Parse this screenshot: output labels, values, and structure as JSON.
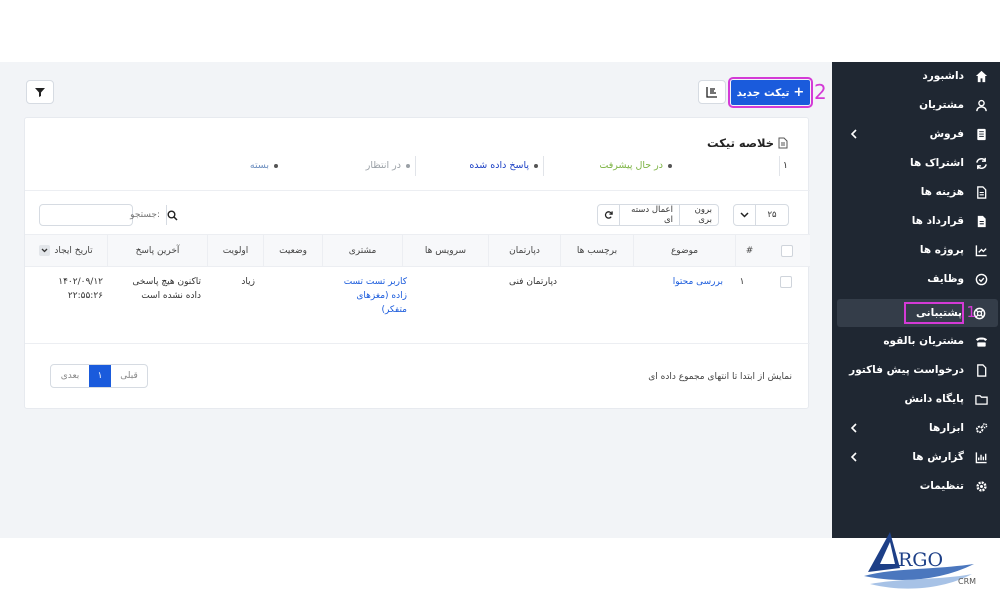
{
  "sidebar": {
    "items": [
      {
        "label": "داشبورد",
        "icon": "home-icon",
        "chevron": false
      },
      {
        "label": "مشتریان",
        "icon": "user-icon",
        "chevron": false
      },
      {
        "label": "فروش",
        "icon": "receipt-icon",
        "chevron": true
      },
      {
        "label": "اشتراک ها",
        "icon": "refresh-icon",
        "chevron": false
      },
      {
        "label": "هزینه ها",
        "icon": "file-text-icon",
        "chevron": false
      },
      {
        "label": "قرارداد ها",
        "icon": "file-icon",
        "chevron": false
      },
      {
        "label": "پروژه ها",
        "icon": "chart-icon",
        "chevron": false
      },
      {
        "label": "وظایف",
        "icon": "check-circle-icon",
        "chevron": false
      },
      {
        "label": "پشتیبانی",
        "icon": "lifebuoy-icon",
        "chevron": false,
        "active": true
      },
      {
        "label": "مشتریان بالقوه",
        "icon": "tty-icon",
        "chevron": false
      },
      {
        "label": "درخواست پیش فاکتور",
        "icon": "file-outline-icon",
        "chevron": false
      },
      {
        "label": "پایگاه دانش",
        "icon": "folder-icon",
        "chevron": false
      },
      {
        "label": "ابزارها",
        "icon": "cogs-icon",
        "chevron": true
      },
      {
        "label": "گزارش ها",
        "icon": "bar-chart-icon",
        "chevron": true
      },
      {
        "label": "تنظیمات",
        "icon": "gear-icon",
        "chevron": false
      }
    ]
  },
  "callouts": {
    "one": "1",
    "two": "2"
  },
  "toolbar": {
    "new_ticket_label": "تیکت جدید",
    "new_ticket_plus": "+"
  },
  "summary": {
    "title": "خلاصه تیکت",
    "stats": [
      {
        "count": "۱",
        "label": "",
        "color": "#333333"
      },
      {
        "label": "در حال پیشرفت",
        "color": "#7cb342"
      },
      {
        "label": "پاسخ داده شده",
        "color": "#1a3fc4"
      },
      {
        "label": "در انتظار",
        "color": "#9aa0a6"
      },
      {
        "label": "بسته",
        "color": "#6c8ebf"
      }
    ]
  },
  "table_tools": {
    "page_size": "۲۵",
    "bulk_action": "اعمال دسته ای",
    "export": "برون بری",
    "search_placeholder": "جستجو:"
  },
  "table": {
    "columns": [
      "#",
      "موضوع",
      "برچسب ها",
      "دپارتمان",
      "سرویس ها",
      "مشتری",
      "وضعیت",
      "اولویت",
      "آخرین پاسخ",
      "تاریخ ایجاد"
    ],
    "rows": [
      {
        "id": "۱",
        "subject": "بررسی محتوا",
        "tags": "",
        "department": "دپارتمان فنی",
        "services": "",
        "customer": "کاربر تست تست زاده (مغزهای متفکر)",
        "status": "",
        "priority": "زیاد",
        "last_reply": "تاکنون هیچ پاسخی داده نشده است",
        "created": "۱۴۰۲/۰۹/۱۲ ۲۲:۵۵:۲۶"
      }
    ]
  },
  "pagination": {
    "prev": "قبلی",
    "current": "۱",
    "next": "بعدی",
    "info": "نمایش از ابتدا تا انتهای مجموع داده ای"
  },
  "logo": {
    "text": "RGO",
    "sub": "CRM"
  },
  "colors": {
    "sidebar_bg": "#1f2732",
    "primary": "#1a5bdc",
    "highlight": "#d43ad6"
  }
}
